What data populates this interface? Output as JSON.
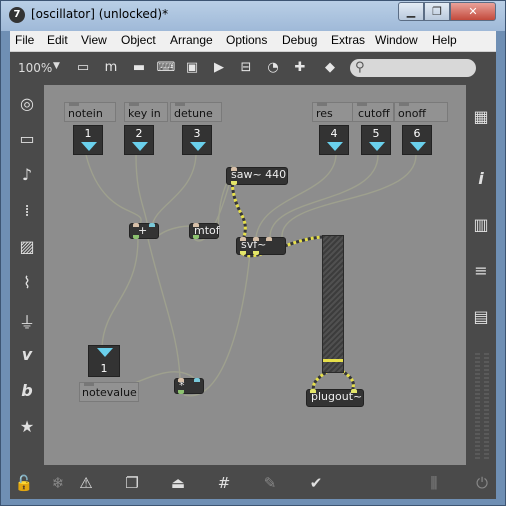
{
  "window": {
    "title": "[oscillator] (unlocked)*",
    "app_icon": "7",
    "buttons": {
      "minimize": "▁",
      "maximize": "❐",
      "close": "✕"
    }
  },
  "menu": [
    "File",
    "Edit",
    "View",
    "Object",
    "Arrange",
    "Options",
    "Debug",
    "Extras",
    "Window",
    "Help"
  ],
  "toolbar": {
    "zoom": "100%",
    "zoom_arrow": "▼",
    "icons": [
      "presentation-icon",
      "text-icon",
      "comment-icon",
      "keyboard-icon",
      "object-icon",
      "play-icon",
      "slider-icon",
      "dial-icon",
      "add-icon",
      "paint-bucket-icon"
    ],
    "icon_glyphs": [
      "▭",
      "m",
      "▬",
      "⌨",
      "▣",
      "▶",
      "⊟",
      "◔",
      "✚",
      "◆"
    ],
    "search_placeholder": ""
  },
  "left_sidebar": {
    "icons": [
      "target-icon",
      "bus-icon",
      "music-note-icon",
      "dots-icon",
      "image-icon",
      "paperclip-icon",
      "plug-icon",
      "vizzie-icon",
      "beap-icon",
      "star-icon"
    ],
    "glyphs": [
      "◎",
      "▭",
      "♪",
      "⁞",
      "▨",
      "⌇",
      "⏚",
      "v",
      "b",
      "★"
    ]
  },
  "right_sidebar": {
    "icons": [
      "grid-icon",
      "info-icon",
      "book-icon",
      "list-icon",
      "reference-icon"
    ],
    "glyphs": [
      "▦",
      "i",
      "▥",
      "≡",
      "▤"
    ]
  },
  "bottom_toolbar": {
    "icons": [
      "unlock-icon",
      "snowflake-icon",
      "warning-icon",
      "windows-icon",
      "presentation-icon",
      "grid-icon",
      "debug-icon",
      "wrench-icon",
      "meter-icon",
      "power-icon"
    ],
    "glyphs": [
      "🔓",
      "❄",
      "⚠",
      "❐",
      "⏏",
      "#",
      "✎",
      "✔",
      "⫼",
      "⏻"
    ]
  },
  "patch": {
    "comments": {
      "notein": "notein",
      "keyin": "key in",
      "detune": "detune",
      "res": "res",
      "cutoff": "cutoff",
      "onoff": "onoff",
      "notevalue": "notevalue"
    },
    "inlets": [
      "1",
      "2",
      "3",
      "4",
      "5",
      "6"
    ],
    "notevalue_number": "1",
    "objects": {
      "saw": "saw~ 440",
      "plus": "+",
      "mtof": "mtof",
      "svf": "svf~",
      "mult": "*",
      "plugout": "plugout~"
    }
  }
}
